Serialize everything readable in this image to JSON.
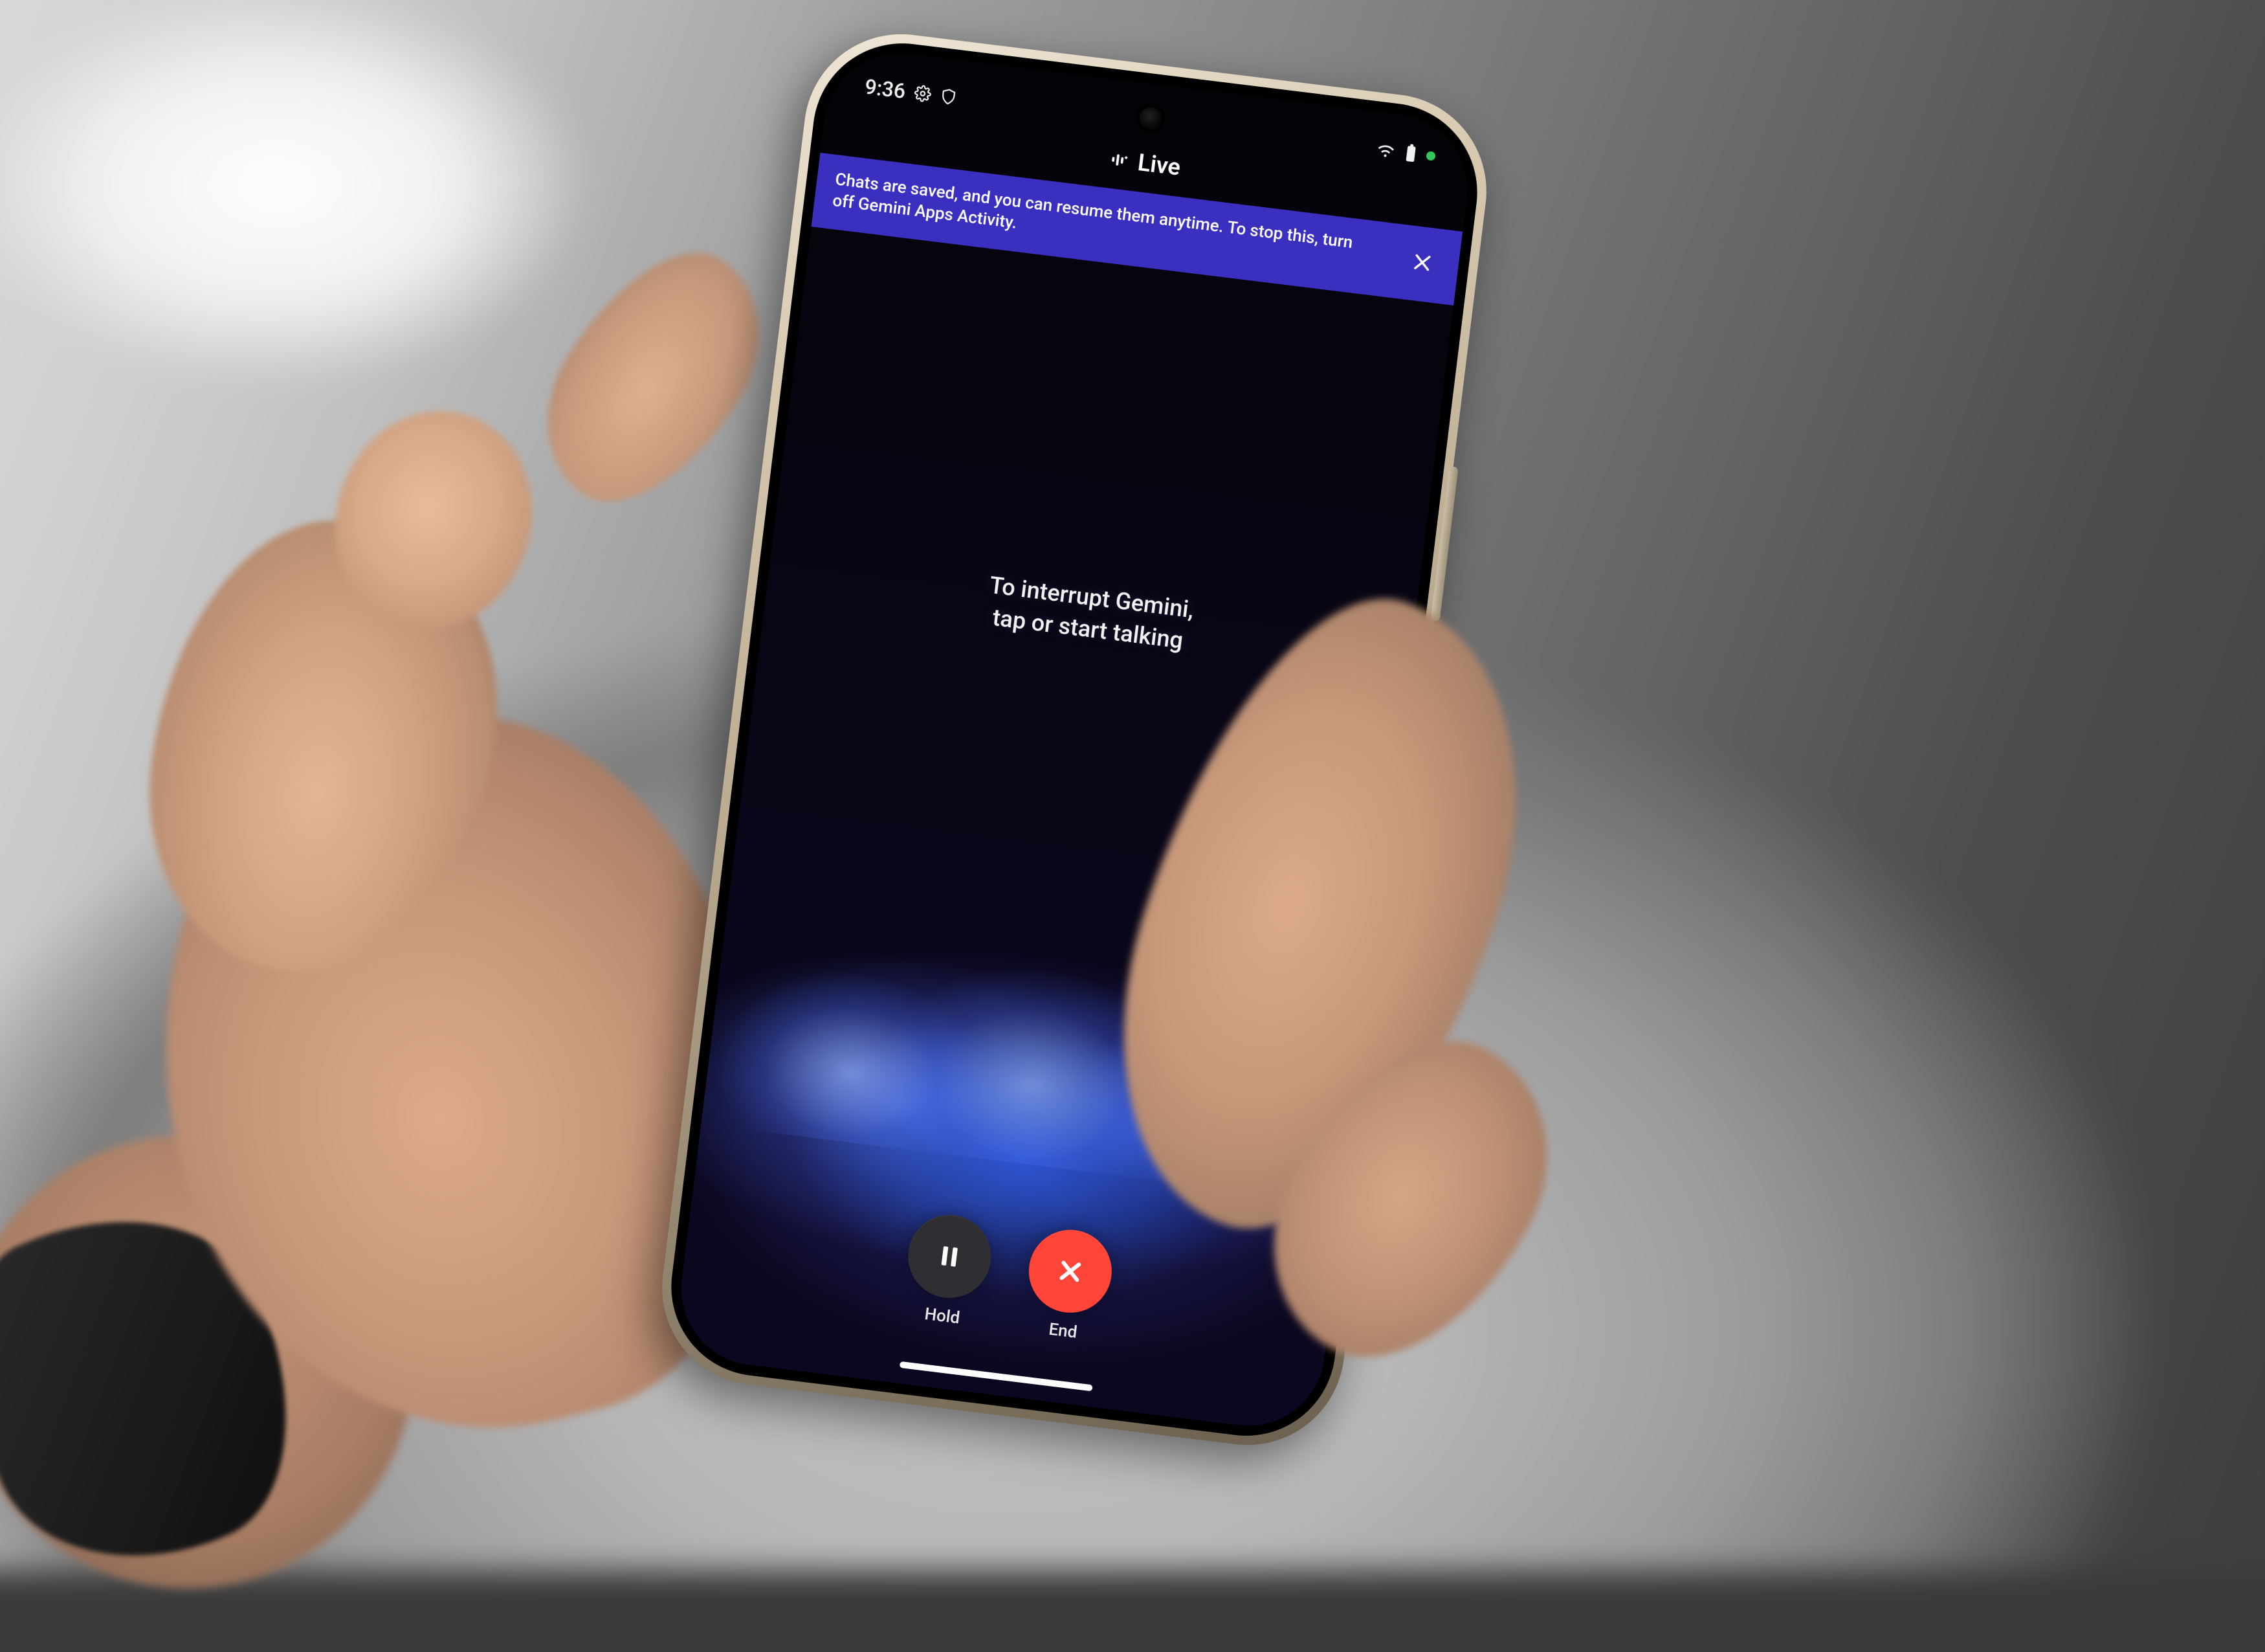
{
  "status_bar": {
    "time": "9:36",
    "left_icons": [
      "settings-icon",
      "shield-icon"
    ],
    "right_icons": [
      "wifi-icon",
      "battery-icon"
    ],
    "privacy_dot": true
  },
  "header": {
    "icon": "gemini-live-icon",
    "title": "Live"
  },
  "banner": {
    "text": "Chats are saved, and you can resume them anytime. To stop this, turn off Gemini Apps Activity.",
    "close_icon": "close-icon"
  },
  "hint": {
    "line1": "To interrupt Gemini,",
    "line2": "tap or start talking"
  },
  "actions": {
    "hold": {
      "label": "Hold",
      "icon": "pause-icon"
    },
    "end": {
      "label": "End",
      "icon": "close-icon"
    }
  },
  "colors": {
    "banner_bg": "#3a2fbf",
    "end_button": "#ff4438",
    "hold_button": "#2f2f33"
  }
}
